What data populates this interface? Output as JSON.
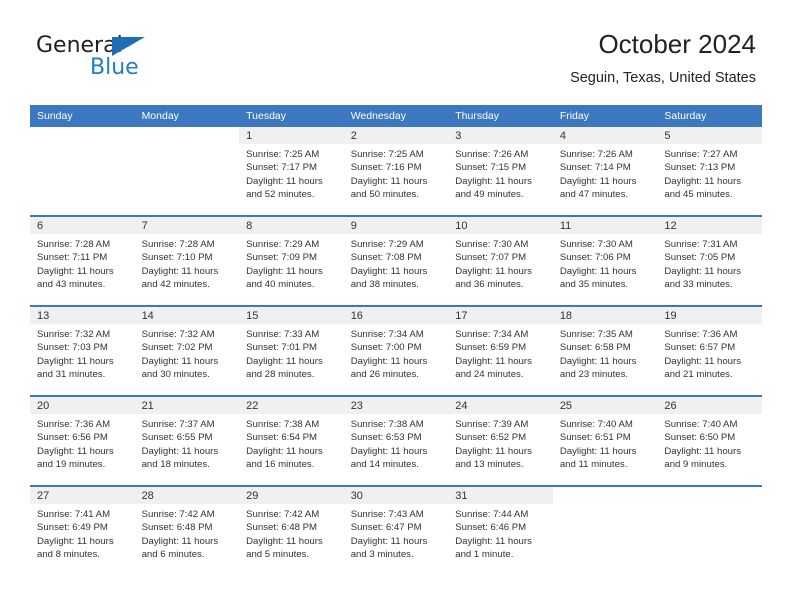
{
  "brand": {
    "name_part1": "General",
    "name_part2": "Blue",
    "accent_color": "#1f7ec4",
    "triangle_color": "#1f6db5"
  },
  "header": {
    "title": "October 2024",
    "subtitle": "Seguin, Texas, United States"
  },
  "calendar": {
    "header_bg": "#3b78bf",
    "daynum_bg": "#f0f0f0",
    "weekday_headers": [
      "Sunday",
      "Monday",
      "Tuesday",
      "Wednesday",
      "Thursday",
      "Friday",
      "Saturday"
    ],
    "weeks": [
      [
        {
          "day": "",
          "sunrise": "",
          "sunset": "",
          "daylight1": "",
          "daylight2": ""
        },
        {
          "day": "",
          "sunrise": "",
          "sunset": "",
          "daylight1": "",
          "daylight2": ""
        },
        {
          "day": "1",
          "sunrise": "Sunrise: 7:25 AM",
          "sunset": "Sunset: 7:17 PM",
          "daylight1": "Daylight: 11 hours",
          "daylight2": "and 52 minutes."
        },
        {
          "day": "2",
          "sunrise": "Sunrise: 7:25 AM",
          "sunset": "Sunset: 7:16 PM",
          "daylight1": "Daylight: 11 hours",
          "daylight2": "and 50 minutes."
        },
        {
          "day": "3",
          "sunrise": "Sunrise: 7:26 AM",
          "sunset": "Sunset: 7:15 PM",
          "daylight1": "Daylight: 11 hours",
          "daylight2": "and 49 minutes."
        },
        {
          "day": "4",
          "sunrise": "Sunrise: 7:26 AM",
          "sunset": "Sunset: 7:14 PM",
          "daylight1": "Daylight: 11 hours",
          "daylight2": "and 47 minutes."
        },
        {
          "day": "5",
          "sunrise": "Sunrise: 7:27 AM",
          "sunset": "Sunset: 7:13 PM",
          "daylight1": "Daylight: 11 hours",
          "daylight2": "and 45 minutes."
        }
      ],
      [
        {
          "day": "6",
          "sunrise": "Sunrise: 7:28 AM",
          "sunset": "Sunset: 7:11 PM",
          "daylight1": "Daylight: 11 hours",
          "daylight2": "and 43 minutes."
        },
        {
          "day": "7",
          "sunrise": "Sunrise: 7:28 AM",
          "sunset": "Sunset: 7:10 PM",
          "daylight1": "Daylight: 11 hours",
          "daylight2": "and 42 minutes."
        },
        {
          "day": "8",
          "sunrise": "Sunrise: 7:29 AM",
          "sunset": "Sunset: 7:09 PM",
          "daylight1": "Daylight: 11 hours",
          "daylight2": "and 40 minutes."
        },
        {
          "day": "9",
          "sunrise": "Sunrise: 7:29 AM",
          "sunset": "Sunset: 7:08 PM",
          "daylight1": "Daylight: 11 hours",
          "daylight2": "and 38 minutes."
        },
        {
          "day": "10",
          "sunrise": "Sunrise: 7:30 AM",
          "sunset": "Sunset: 7:07 PM",
          "daylight1": "Daylight: 11 hours",
          "daylight2": "and 36 minutes."
        },
        {
          "day": "11",
          "sunrise": "Sunrise: 7:30 AM",
          "sunset": "Sunset: 7:06 PM",
          "daylight1": "Daylight: 11 hours",
          "daylight2": "and 35 minutes."
        },
        {
          "day": "12",
          "sunrise": "Sunrise: 7:31 AM",
          "sunset": "Sunset: 7:05 PM",
          "daylight1": "Daylight: 11 hours",
          "daylight2": "and 33 minutes."
        }
      ],
      [
        {
          "day": "13",
          "sunrise": "Sunrise: 7:32 AM",
          "sunset": "Sunset: 7:03 PM",
          "daylight1": "Daylight: 11 hours",
          "daylight2": "and 31 minutes."
        },
        {
          "day": "14",
          "sunrise": "Sunrise: 7:32 AM",
          "sunset": "Sunset: 7:02 PM",
          "daylight1": "Daylight: 11 hours",
          "daylight2": "and 30 minutes."
        },
        {
          "day": "15",
          "sunrise": "Sunrise: 7:33 AM",
          "sunset": "Sunset: 7:01 PM",
          "daylight1": "Daylight: 11 hours",
          "daylight2": "and 28 minutes."
        },
        {
          "day": "16",
          "sunrise": "Sunrise: 7:34 AM",
          "sunset": "Sunset: 7:00 PM",
          "daylight1": "Daylight: 11 hours",
          "daylight2": "and 26 minutes."
        },
        {
          "day": "17",
          "sunrise": "Sunrise: 7:34 AM",
          "sunset": "Sunset: 6:59 PM",
          "daylight1": "Daylight: 11 hours",
          "daylight2": "and 24 minutes."
        },
        {
          "day": "18",
          "sunrise": "Sunrise: 7:35 AM",
          "sunset": "Sunset: 6:58 PM",
          "daylight1": "Daylight: 11 hours",
          "daylight2": "and 23 minutes."
        },
        {
          "day": "19",
          "sunrise": "Sunrise: 7:36 AM",
          "sunset": "Sunset: 6:57 PM",
          "daylight1": "Daylight: 11 hours",
          "daylight2": "and 21 minutes."
        }
      ],
      [
        {
          "day": "20",
          "sunrise": "Sunrise: 7:36 AM",
          "sunset": "Sunset: 6:56 PM",
          "daylight1": "Daylight: 11 hours",
          "daylight2": "and 19 minutes."
        },
        {
          "day": "21",
          "sunrise": "Sunrise: 7:37 AM",
          "sunset": "Sunset: 6:55 PM",
          "daylight1": "Daylight: 11 hours",
          "daylight2": "and 18 minutes."
        },
        {
          "day": "22",
          "sunrise": "Sunrise: 7:38 AM",
          "sunset": "Sunset: 6:54 PM",
          "daylight1": "Daylight: 11 hours",
          "daylight2": "and 16 minutes."
        },
        {
          "day": "23",
          "sunrise": "Sunrise: 7:38 AM",
          "sunset": "Sunset: 6:53 PM",
          "daylight1": "Daylight: 11 hours",
          "daylight2": "and 14 minutes."
        },
        {
          "day": "24",
          "sunrise": "Sunrise: 7:39 AM",
          "sunset": "Sunset: 6:52 PM",
          "daylight1": "Daylight: 11 hours",
          "daylight2": "and 13 minutes."
        },
        {
          "day": "25",
          "sunrise": "Sunrise: 7:40 AM",
          "sunset": "Sunset: 6:51 PM",
          "daylight1": "Daylight: 11 hours",
          "daylight2": "and 11 minutes."
        },
        {
          "day": "26",
          "sunrise": "Sunrise: 7:40 AM",
          "sunset": "Sunset: 6:50 PM",
          "daylight1": "Daylight: 11 hours",
          "daylight2": "and 9 minutes."
        }
      ],
      [
        {
          "day": "27",
          "sunrise": "Sunrise: 7:41 AM",
          "sunset": "Sunset: 6:49 PM",
          "daylight1": "Daylight: 11 hours",
          "daylight2": "and 8 minutes."
        },
        {
          "day": "28",
          "sunrise": "Sunrise: 7:42 AM",
          "sunset": "Sunset: 6:48 PM",
          "daylight1": "Daylight: 11 hours",
          "daylight2": "and 6 minutes."
        },
        {
          "day": "29",
          "sunrise": "Sunrise: 7:42 AM",
          "sunset": "Sunset: 6:48 PM",
          "daylight1": "Daylight: 11 hours",
          "daylight2": "and 5 minutes."
        },
        {
          "day": "30",
          "sunrise": "Sunrise: 7:43 AM",
          "sunset": "Sunset: 6:47 PM",
          "daylight1": "Daylight: 11 hours",
          "daylight2": "and 3 minutes."
        },
        {
          "day": "31",
          "sunrise": "Sunrise: 7:44 AM",
          "sunset": "Sunset: 6:46 PM",
          "daylight1": "Daylight: 11 hours",
          "daylight2": "and 1 minute."
        },
        {
          "day": "",
          "sunrise": "",
          "sunset": "",
          "daylight1": "",
          "daylight2": ""
        },
        {
          "day": "",
          "sunrise": "",
          "sunset": "",
          "daylight1": "",
          "daylight2": ""
        }
      ]
    ]
  }
}
